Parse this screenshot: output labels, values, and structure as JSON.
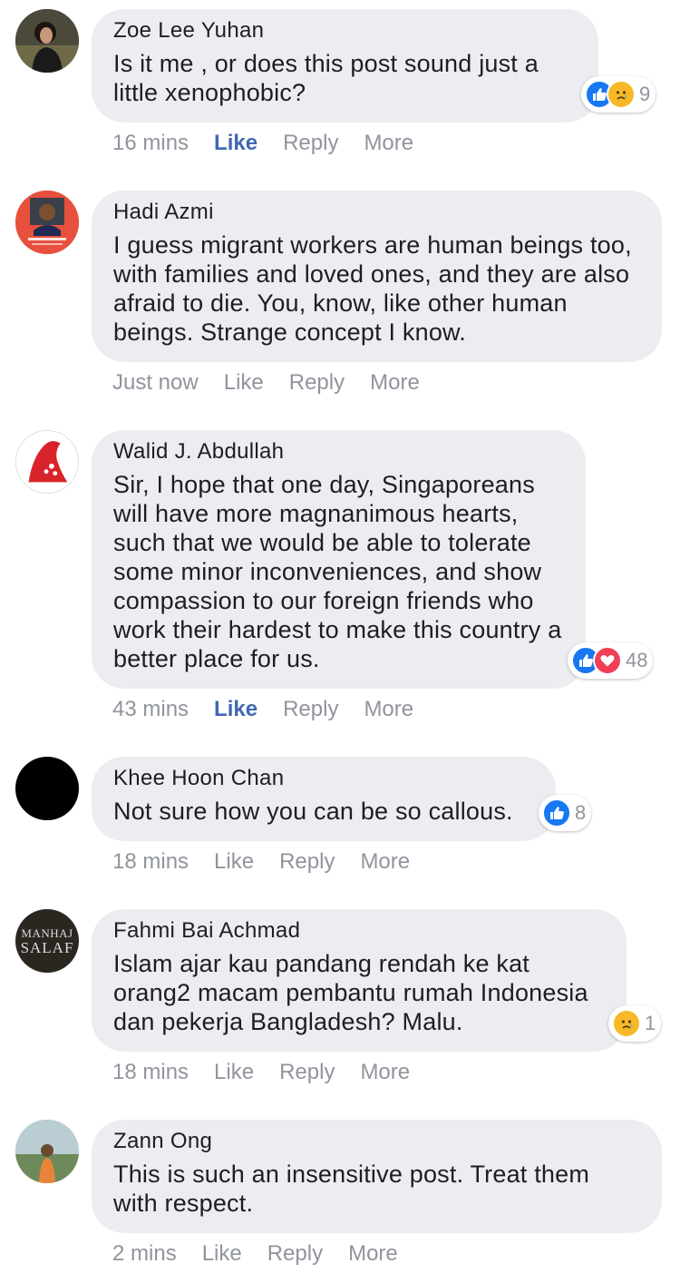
{
  "comments": [
    {
      "author": "Zoe Lee Yuhan",
      "text": "Is it me , or does this post sound just a little xenophobic?",
      "time": "16 mins",
      "like": "Like",
      "reply": "Reply",
      "more": "More",
      "liked": true,
      "reactions": [
        "like",
        "sad"
      ],
      "reaction_count": "9"
    },
    {
      "author": "Hadi Azmi",
      "text": "I guess migrant workers are human beings too, with families and loved ones, and they are also afraid to die. You, know, like other human beings. Strange concept I know.",
      "time": "Just now",
      "like": "Like",
      "reply": "Reply",
      "more": "More",
      "liked": false,
      "avatar_badge": "#StayAtHome"
    },
    {
      "author": "Walid J. Abdullah",
      "text": "Sir, I hope that one day, Singaporeans will have more magnanimous hearts, such that we would be able to tolerate some minor inconveniences, and show compassion to our foreign friends who work their hardest to make this country a better place for us.",
      "time": "43 mins",
      "like": "Like",
      "reply": "Reply",
      "more": "More",
      "liked": true,
      "reactions": [
        "like",
        "love"
      ],
      "reaction_count": "48"
    },
    {
      "author": "Khee Hoon Chan",
      "text": "Not sure how you can be so callous.",
      "time": "18 mins",
      "like": "Like",
      "reply": "Reply",
      "more": "More",
      "liked": false,
      "reactions": [
        "like"
      ],
      "reaction_count": "8"
    },
    {
      "author": "Fahmi Bai Achmad",
      "text": "Islam ajar kau pandang rendah ke kat orang2 macam pembantu rumah Indonesia dan pekerja Bangladesh? Malu.",
      "time": "18 mins",
      "like": "Like",
      "reply": "Reply",
      "more": "More",
      "liked": false,
      "reactions": [
        "sad"
      ],
      "reaction_count": "1",
      "avatar_text": [
        "MANHAJ",
        "SALAF"
      ]
    },
    {
      "author": "Zann Ong",
      "text": "This is such an insensitive post. Treat them with respect.",
      "time": "2 mins",
      "like": "Like",
      "reply": "Reply",
      "more": "More",
      "liked": false
    }
  ],
  "colors": {
    "bubble": "#ebedf0",
    "link_blue": "#4267b2",
    "meta_gray": "#90949c",
    "text": "#1c1e21",
    "like_blue": "#1877f2",
    "love_red": "#f33e58",
    "sad_yellow": "#f7b928"
  }
}
